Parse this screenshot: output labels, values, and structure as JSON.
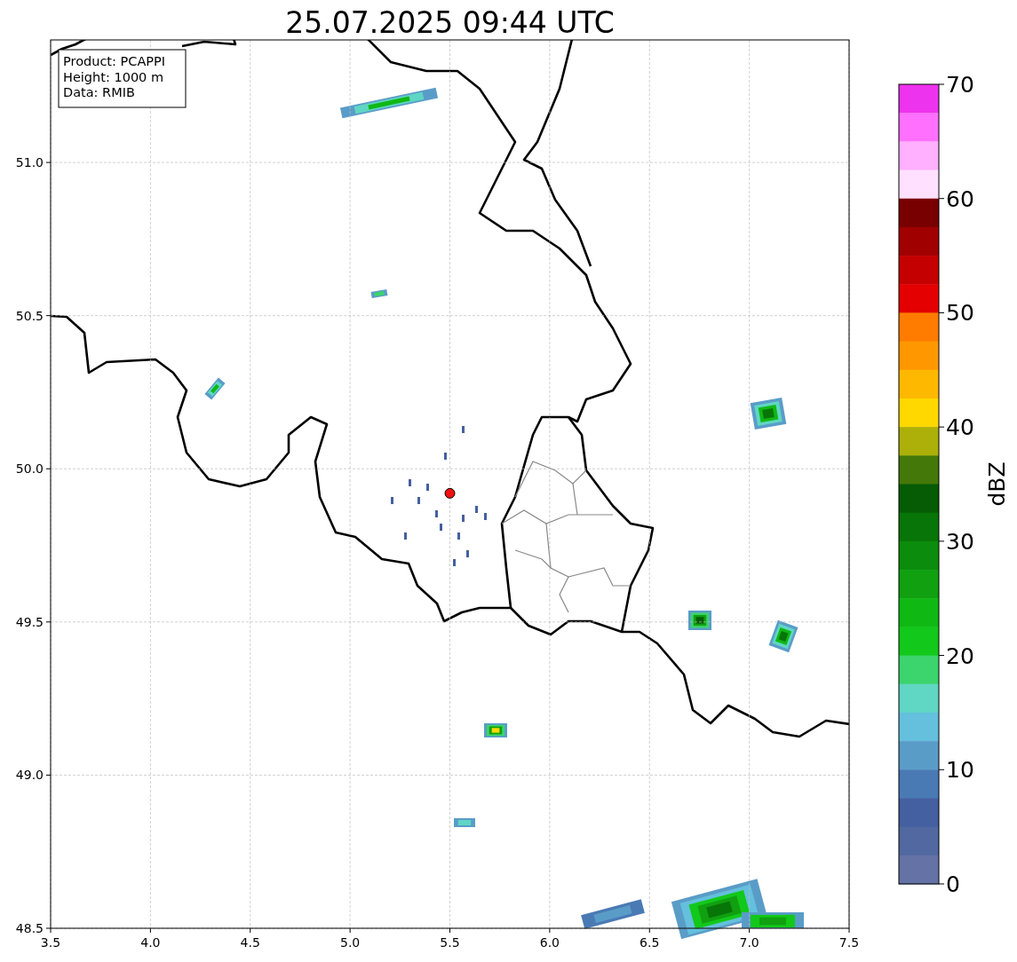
{
  "title": "25.07.2025 09:44 UTC",
  "map": {
    "info_lines": [
      "Product: PCAPPI",
      "Height: 1000 m",
      "Data: RMIB"
    ],
    "chart_data": {
      "type": "scatter",
      "grid": true,
      "xlim": [
        3.5,
        7.5
      ],
      "ylim": [
        48.5,
        51.4
      ],
      "xticks": [
        {
          "value": 3.5,
          "label": "3.5"
        },
        {
          "value": 4.0,
          "label": "4.0"
        },
        {
          "value": 4.5,
          "label": "4.5"
        },
        {
          "value": 5.0,
          "label": "5.0"
        },
        {
          "value": 5.5,
          "label": "5.5"
        },
        {
          "value": 6.0,
          "label": "6.0"
        },
        {
          "value": 6.5,
          "label": "6.5"
        },
        {
          "value": 7.0,
          "label": "7.0"
        },
        {
          "value": 7.5,
          "label": "7.5"
        }
      ],
      "yticks": [
        {
          "value": 51.0,
          "label": "51.0"
        },
        {
          "value": 50.5,
          "label": "50.5"
        },
        {
          "value": 50.0,
          "label": "50.0"
        },
        {
          "value": 49.5,
          "label": "49.5"
        },
        {
          "value": 49.0,
          "label": "49.0"
        },
        {
          "value": 48.5,
          "label": "48.5"
        }
      ],
      "x": [
        5.5
      ],
      "series": [
        {
          "color": "#ee1111",
          "values": [
            49.92
          ]
        }
      ]
    }
  },
  "colorbar": {
    "label": "dBZ",
    "ticks": [
      "70",
      "60",
      "50",
      "40",
      "30",
      "20",
      "10",
      "0"
    ],
    "segments": [
      {
        "color": "#ee33ee"
      },
      {
        "color": "#ff70ff"
      },
      {
        "color": "#ffb0ff"
      },
      {
        "color": "#ffe0ff"
      },
      {
        "color": "#780000"
      },
      {
        "color": "#a00000"
      },
      {
        "color": "#c40000"
      },
      {
        "color": "#e40000"
      },
      {
        "color": "#ff7c00"
      },
      {
        "color": "#ff9800"
      },
      {
        "color": "#ffb800"
      },
      {
        "color": "#ffd800"
      },
      {
        "color": "#acb008"
      },
      {
        "color": "#447808"
      },
      {
        "color": "#055c05"
      },
      {
        "color": "#087508"
      },
      {
        "color": "#0c8c0c"
      },
      {
        "color": "#10a010"
      },
      {
        "color": "#10b814"
      },
      {
        "color": "#12c81a"
      },
      {
        "color": "#3cd46c"
      },
      {
        "color": "#60d6c4"
      },
      {
        "color": "#64c0dc"
      },
      {
        "color": "#5a9cc8"
      },
      {
        "color": "#4a7ab4"
      },
      {
        "color": "#4560a0"
      },
      {
        "color": "#5168a0"
      },
      {
        "color": "#6572a6"
      }
    ]
  }
}
